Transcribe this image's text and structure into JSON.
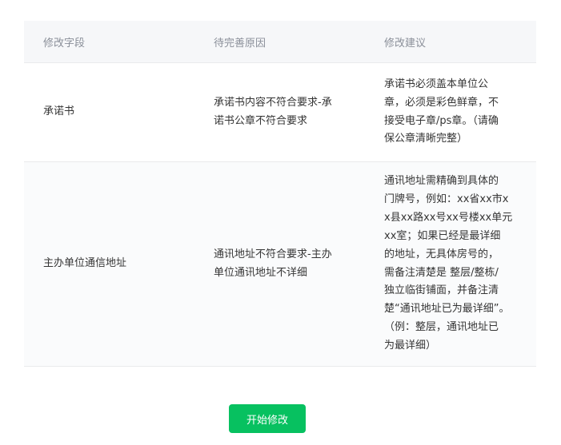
{
  "table": {
    "headers": [
      "修改字段",
      "待完善原因",
      "修改建议"
    ],
    "rows": [
      {
        "field": "承诺书",
        "reason": "承诺书内容不符合要求-承\n诺书公章不符合要求",
        "suggestion": "承诺书必须盖本单位公\n章，必须是彩色鲜章，不\n接受电子章/ps章。（请确\n保公章清晰完整）"
      },
      {
        "field": "主办单位通信地址",
        "reason": "通讯地址不符合要求-主办\n单位通讯地址不详细",
        "suggestion": "通讯地址需精确到具体的\n门牌号，例如：xx省xx市x\nx县xx路xx号xx号楼xx单元\nxx室；如果已经是最详细\n的地址，无具体房号的，\n需备注清楚是 整层/整栋/\n独立临街铺面，并备注清\n楚“通讯地址已为最详细”。\n（例：整层，通讯地址已\n为最详细）"
      }
    ]
  },
  "action": {
    "start_label": "开始修改",
    "color": "#07c160"
  }
}
